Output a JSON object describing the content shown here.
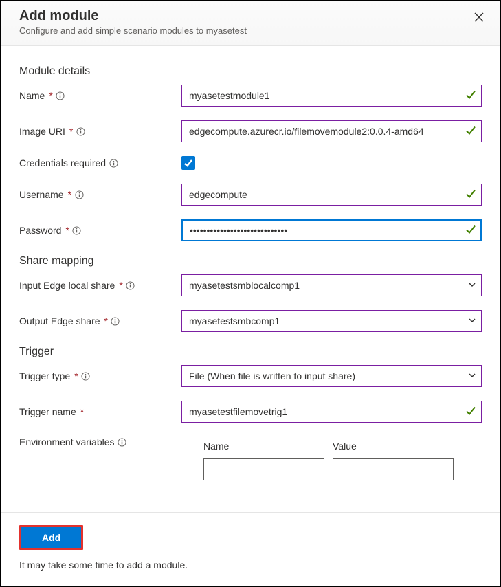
{
  "header": {
    "title": "Add module",
    "subtitle": "Configure and add simple scenario modules to myasetest"
  },
  "sections": {
    "details": "Module details",
    "share": "Share mapping",
    "trigger": "Trigger"
  },
  "labels": {
    "name": "Name",
    "image_uri": "Image URI",
    "credentials": "Credentials required",
    "username": "Username",
    "password": "Password",
    "input_share": "Input Edge local share",
    "output_share": "Output Edge share",
    "trigger_type": "Trigger type",
    "trigger_name": "Trigger name",
    "env_vars": "Environment variables"
  },
  "values": {
    "name": "myasetestmodule1",
    "image_uri": "edgecompute.azurecr.io/filemovemodule2:0.0.4-amd64",
    "credentials": true,
    "username": "edgecompute",
    "password": "•••••••••••••••••••••••••••••",
    "input_share": "myasetestsmblocalcomp1",
    "output_share": "myasetestsmbcomp1",
    "trigger_type": "File (When file is written to input share)",
    "trigger_name": "myasetestfilemovetrig1"
  },
  "env_table": {
    "col_name": "Name",
    "col_value": "Value"
  },
  "footer": {
    "add": "Add",
    "note": "It may take some time to add a module."
  }
}
